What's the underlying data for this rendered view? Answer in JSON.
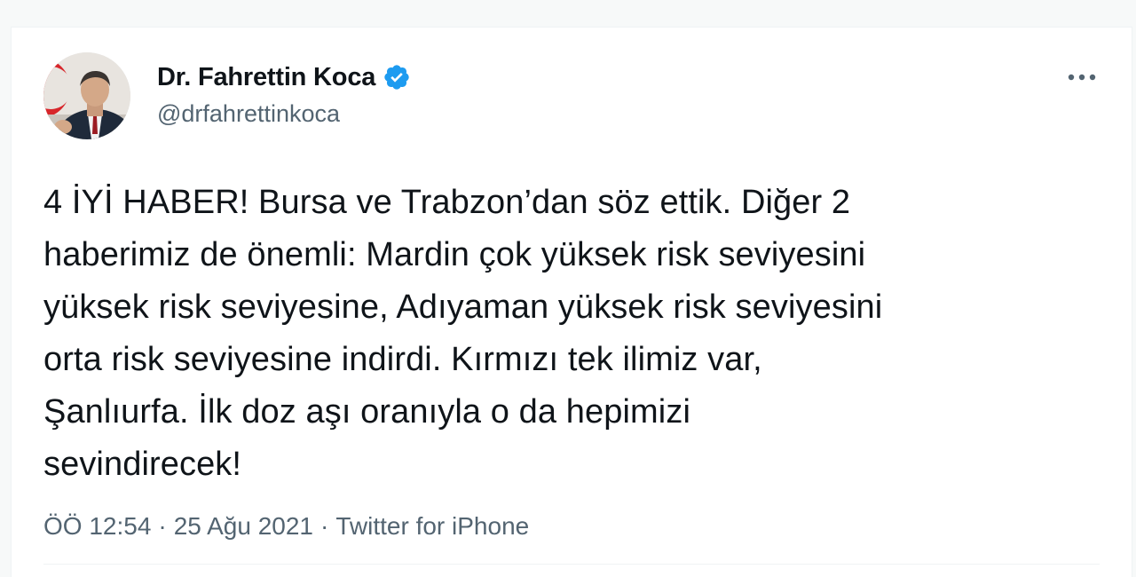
{
  "tweet": {
    "author": {
      "display_name": "Dr. Fahrettin Koca",
      "handle": "@drfahrettinkoca",
      "verified": true,
      "verified_icon": "verified-badge-icon",
      "avatar": "profile-photo"
    },
    "more_icon": "more-options-icon",
    "text": "4 İYİ HABER! Bursa ve Trabzon’dan söz ettik. Diğer 2\nhaberimiz de önemli: Mardin çok yüksek risk seviyesini\nyüksek risk seviyesine, Adıyaman yüksek risk seviyesini\norta risk seviyesine indirdi. Kırmızı tek ilimiz var,\nŞanlıurfa. İlk doz aşı oranıyla o da hepimizi\nsevindirecek!",
    "time": "ÖÖ 12:54",
    "date": "25 Ağu 2021",
    "separator": "·",
    "source": "Twitter for iPhone"
  },
  "colors": {
    "verified_blue": "#1d9bf0",
    "secondary_text": "#536471",
    "primary_text": "#0f1419"
  }
}
